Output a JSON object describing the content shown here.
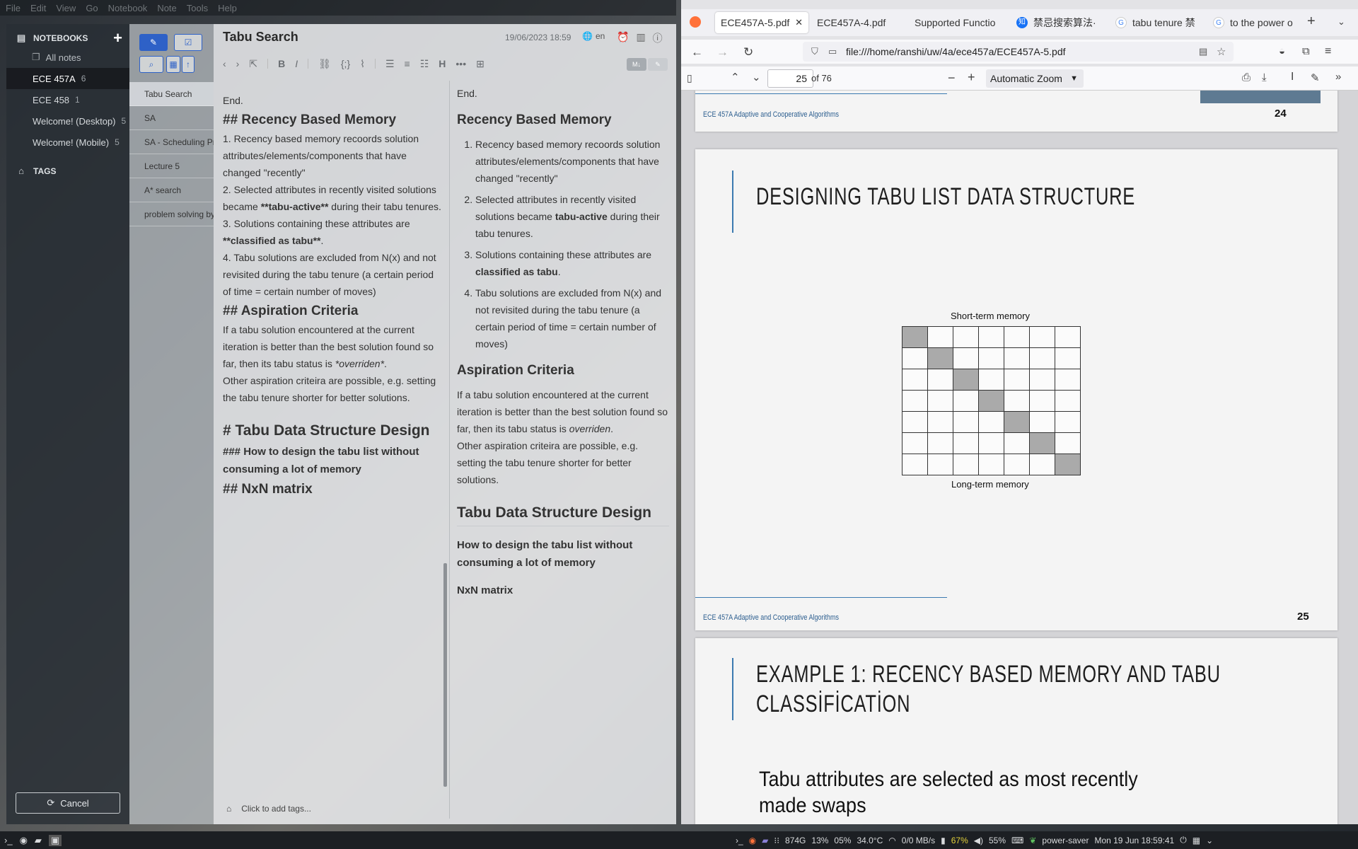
{
  "menu": [
    "File",
    "Edit",
    "View",
    "Go",
    "Notebook",
    "Note",
    "Tools",
    "Help"
  ],
  "sidebar": {
    "notebooks_label": "NOTEBOOKS",
    "all_notes": "All notes",
    "notebooks": [
      {
        "name": "ECE 457A",
        "count": "6"
      },
      {
        "name": "ECE 458",
        "count": "1"
      },
      {
        "name": "Welcome! (Desktop)",
        "count": "5"
      },
      {
        "name": "Welcome! (Mobile)",
        "count": "5"
      }
    ],
    "tags_label": "TAGS",
    "cancel_label": "Cancel"
  },
  "notelist": {
    "items": [
      "Tabu Search",
      "SA",
      "SA - Scheduling Pr",
      "Lecture 5",
      "A* search",
      "problem solving by"
    ]
  },
  "editor": {
    "title": "Tabu Search",
    "date": "19/06/2023 18:59",
    "lang": "en",
    "md_label": "M↓",
    "add_tags": "Click to add tags...",
    "raw": {
      "end": "End.",
      "h_recency": "## Recency Based Memory",
      "r1": "1. Recency based memory recoords solution attributes/elements/components that have changed \"recently\"",
      "r2a": "2. Selected attributes in recently visited solutions became ",
      "r2b": "**tabu-active**",
      "r2c": " during their tabu tenures.",
      "r3a": "3. Solutions containing these attributes are ",
      "r3b": "**classified as tabu**",
      "r3c": ".",
      "r4": "4. Tabu solutions are excluded from N(x) and not revisited during the tabu tenure (a certain period of time = certain number of moves)",
      "h_asp": "## Aspiration Criteria",
      "asp1a": "If a tabu solution encountered at the current iteration is better than the best solution found so far, then its tabu status is ",
      "asp1b": "*overriden*",
      "asp1c": ".",
      "asp2": "Other aspiration criteira are possible, e.g. setting the tabu tenure shorter for better solutions.",
      "h_tds": "# Tabu Data Structure Design",
      "h_how": "### How to design the tabu list without consuming a lot of memory",
      "h_nxn": "## NxN matrix"
    },
    "preview": {
      "end": "End.",
      "h_recency": "Recency Based Memory",
      "li1": "Recency based memory recoords solution attributes/elements/components that have changed \"recently\"",
      "li2a": "Selected attributes in recently visited solutions became ",
      "li2b": "tabu-active",
      "li2c": " during their tabu tenures.",
      "li3a": "Solutions containing these attributes are ",
      "li3b": "classified as tabu",
      "li3c": ".",
      "li4": "Tabu solutions are excluded from N(x) and not revisited during the tabu tenure (a certain period of time = certain number of moves)",
      "h_asp": "Aspiration Criteria",
      "asp1a": "If a tabu solution encountered at the current iteration is better than the best solution found so far, then its tabu status is ",
      "asp1b": "overriden",
      "asp1c": ".",
      "asp2": "Other aspiration criteira are possible, e.g. setting the tabu tenure shorter for better solutions.",
      "h_tds": "Tabu Data Structure Design",
      "h_how": "How to design the tabu list without consuming a lot of memory",
      "h_nxn": "NxN matrix"
    }
  },
  "browser": {
    "tabs": [
      {
        "label": "ECE457A-5.pdf",
        "active": true
      },
      {
        "label": "ECE457A-4.pdf"
      },
      {
        "label": "Supported Functio"
      },
      {
        "label": "禁忌搜索算法·"
      },
      {
        "label": "tabu tenure 禁"
      },
      {
        "label": "to the power o"
      }
    ],
    "url": "file:///home/ranshi/uw/4a/ece457a/ECE457A-5.pdf",
    "page_number": "25",
    "of_pages": "of 76",
    "zoom": "Automatic Zoom"
  },
  "pdf": {
    "course": "ECE 457A Adaptive and Cooperative Algorithms",
    "page24": "24",
    "page25": "25",
    "slide1_title": "DESIGNING TABU LIST DATA STRUCTURE",
    "short_term": "Short-term memory",
    "long_term": "Long-term memory",
    "slide2_title1": "EXAMPLE 1: RECENCY BASED MEMORY AND TABU",
    "slide2_title2": "CLASSİFİCATİON",
    "slide2_text1": "Tabu attributes are selected as most recently",
    "slide2_text2": "made swaps"
  },
  "taskbar": {
    "disk": "874G",
    "cpu": "13%",
    "mem": "05%",
    "temp": "34.0°C",
    "net": "0/0 MB/s",
    "battery": "67%",
    "volume": "55%",
    "power_mode": "power-saver",
    "datetime": "Mon 19 Jun 18:59:41"
  }
}
